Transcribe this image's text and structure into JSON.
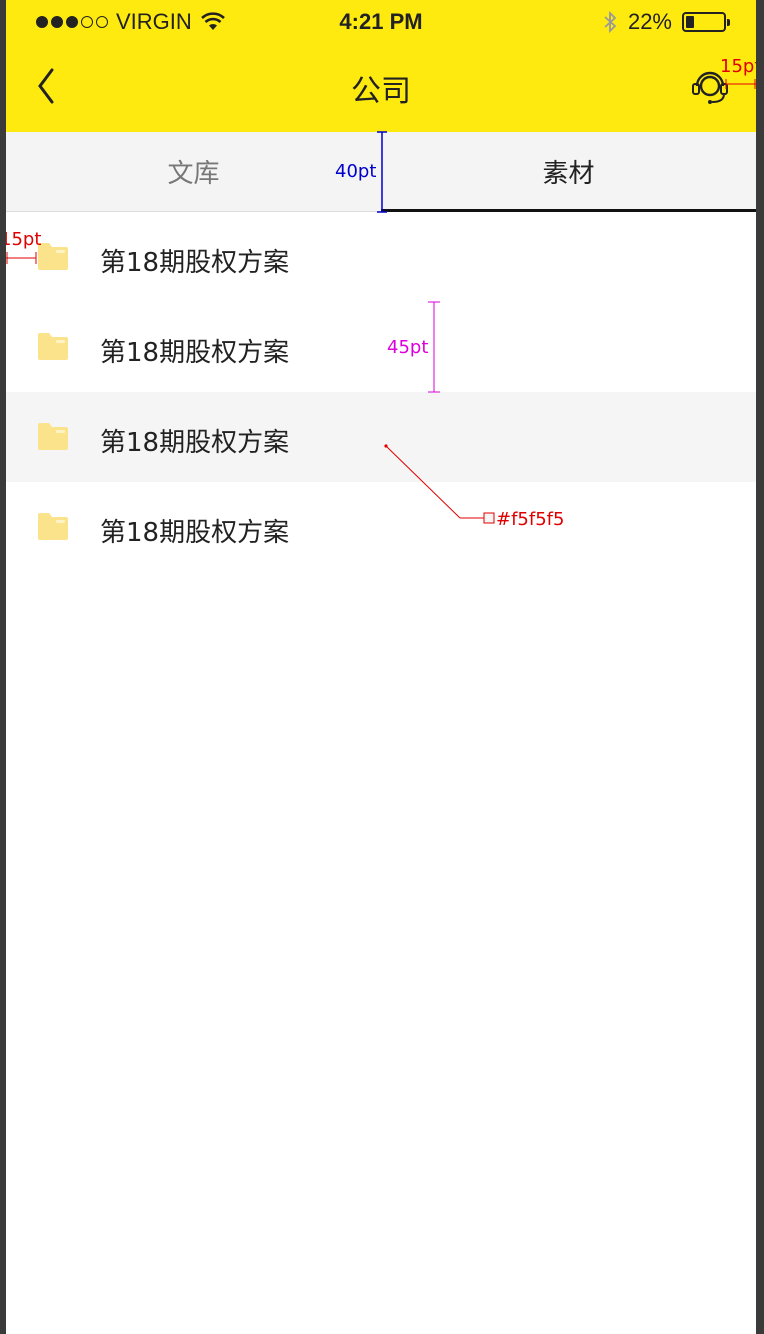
{
  "status_bar": {
    "carrier": "VIRGIN",
    "time": "4:21 PM",
    "battery": "22%",
    "battery_level": 0.22,
    "signal_dots_filled": 3,
    "signal_dots_total": 5
  },
  "nav": {
    "title": "公司",
    "back_icon": "chevron-left-icon",
    "service_icon": "headset-icon"
  },
  "tabs": [
    {
      "label": "文库",
      "active": false
    },
    {
      "label": "素材",
      "active": true
    }
  ],
  "list": {
    "items": [
      {
        "label": "第18期股权方案",
        "highlighted": false
      },
      {
        "label": "第18期股权方案",
        "highlighted": false
      },
      {
        "label": "第18期股权方案",
        "highlighted": true
      },
      {
        "label": "第18期股权方案",
        "highlighted": false
      }
    ]
  },
  "annotations": {
    "service_margin": "15pt",
    "tab_height": "40pt",
    "list_left_margin": "15pt",
    "row_height": "45pt",
    "highlight_color": "#f5f5f5"
  },
  "colors": {
    "header_bg": "#ffea10",
    "tab_bg": "#f4f4f4",
    "folder": "#fbe38c",
    "highlight_row": "#f5f5f5",
    "annotation_red": "#e00000",
    "annotation_blue": "#0000cc",
    "annotation_magenta": "#dd00dd"
  }
}
